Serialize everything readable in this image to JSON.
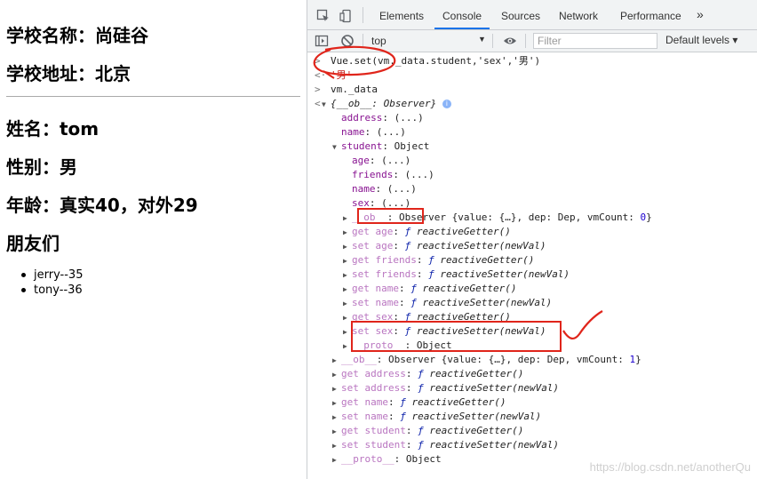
{
  "page": {
    "school_name": "学校名称：尚硅谷",
    "school_address": "学校地址：北京",
    "student_name": "姓名：tom",
    "student_sex": "性别：男",
    "student_age": "年龄：真实40，对外29",
    "friends_heading": "朋友们",
    "friends": [
      "jerry--35",
      "tony--36"
    ]
  },
  "devtools": {
    "tabs": [
      "Elements",
      "Console",
      "Sources",
      "Network",
      "Performance"
    ],
    "active_tab": "Console",
    "more_tabs_icon": "»",
    "context": "top",
    "filter_placeholder": "Filter",
    "levels": "Default levels ▾",
    "console_lines": [
      {
        "gutter": ">",
        "indent": 0,
        "html": "Vue.set(vm._data.student,'sex','男')",
        "kind": "input"
      },
      {
        "gutter": "<·",
        "indent": 0,
        "html": "'男'",
        "kind": "result"
      },
      {
        "gutter": ">",
        "indent": 0,
        "html": "vm._data",
        "kind": "input"
      },
      {
        "gutter": "<·",
        "indent": 0,
        "tri": "▼",
        "parts": [
          [
            "obj",
            "{__ob__: Observer}"
          ]
        ],
        "info": true
      },
      {
        "indent": 1,
        "parts": [
          [
            "k",
            "address"
          ],
          [
            "v",
            ": (...)"
          ]
        ]
      },
      {
        "indent": 1,
        "parts": [
          [
            "k",
            "name"
          ],
          [
            "v",
            ": (...)"
          ]
        ]
      },
      {
        "indent": 1,
        "tri": "▼",
        "parts": [
          [
            "k",
            "student"
          ],
          [
            "v",
            ": Object"
          ]
        ]
      },
      {
        "indent": 2,
        "parts": [
          [
            "k",
            "age"
          ],
          [
            "v",
            ": (...)"
          ]
        ]
      },
      {
        "indent": 2,
        "parts": [
          [
            "k",
            "friends"
          ],
          [
            "v",
            ": (...)"
          ]
        ]
      },
      {
        "indent": 2,
        "parts": [
          [
            "k",
            "name"
          ],
          [
            "v",
            ": (...)"
          ]
        ]
      },
      {
        "indent": 2,
        "parts": [
          [
            "k",
            "sex"
          ],
          [
            "v",
            ": (...)"
          ]
        ]
      },
      {
        "indent": 2,
        "tri": "▶",
        "parts": [
          [
            "kd",
            "__ob__"
          ],
          [
            "v",
            ": Observer {value: {…}, dep: Dep, vmCount: "
          ],
          [
            "n",
            "0"
          ],
          [
            "v",
            "}"
          ]
        ]
      },
      {
        "indent": 2,
        "tri": "▶",
        "parts": [
          [
            "kd",
            "get age"
          ],
          [
            "v",
            ": "
          ],
          [
            "fs",
            "ƒ "
          ],
          [
            "f",
            "reactiveGetter()"
          ]
        ]
      },
      {
        "indent": 2,
        "tri": "▶",
        "parts": [
          [
            "kd",
            "set age"
          ],
          [
            "v",
            ": "
          ],
          [
            "fs",
            "ƒ "
          ],
          [
            "f",
            "reactiveSetter(newVal)"
          ]
        ]
      },
      {
        "indent": 2,
        "tri": "▶",
        "parts": [
          [
            "kd",
            "get friends"
          ],
          [
            "v",
            ": "
          ],
          [
            "fs",
            "ƒ "
          ],
          [
            "f",
            "reactiveGetter()"
          ]
        ]
      },
      {
        "indent": 2,
        "tri": "▶",
        "parts": [
          [
            "kd",
            "set friends"
          ],
          [
            "v",
            ": "
          ],
          [
            "fs",
            "ƒ "
          ],
          [
            "f",
            "reactiveSetter(newVal)"
          ]
        ]
      },
      {
        "indent": 2,
        "tri": "▶",
        "parts": [
          [
            "kd",
            "get name"
          ],
          [
            "v",
            ": "
          ],
          [
            "fs",
            "ƒ "
          ],
          [
            "f",
            "reactiveGetter()"
          ]
        ]
      },
      {
        "indent": 2,
        "tri": "▶",
        "parts": [
          [
            "kd",
            "set name"
          ],
          [
            "v",
            ": "
          ],
          [
            "fs",
            "ƒ "
          ],
          [
            "f",
            "reactiveSetter(newVal)"
          ]
        ]
      },
      {
        "indent": 2,
        "tri": "▶",
        "parts": [
          [
            "kd",
            "get sex"
          ],
          [
            "v",
            ": "
          ],
          [
            "fs",
            "ƒ "
          ],
          [
            "f",
            "reactiveGetter()"
          ]
        ]
      },
      {
        "indent": 2,
        "tri": "▶",
        "parts": [
          [
            "kd",
            "set sex"
          ],
          [
            "v",
            ": "
          ],
          [
            "fs",
            "ƒ "
          ],
          [
            "f",
            "reactiveSetter(newVal)"
          ]
        ]
      },
      {
        "indent": 2,
        "tri": "▶",
        "parts": [
          [
            "kd",
            "__proto__"
          ],
          [
            "v",
            ": Object"
          ]
        ]
      },
      {
        "indent": 1,
        "tri": "▶",
        "parts": [
          [
            "kd",
            "__ob__"
          ],
          [
            "v",
            ": Observer {value: {…}, dep: Dep, vmCount: "
          ],
          [
            "n",
            "1"
          ],
          [
            "v",
            "}"
          ]
        ]
      },
      {
        "indent": 1,
        "tri": "▶",
        "parts": [
          [
            "kd",
            "get address"
          ],
          [
            "v",
            ": "
          ],
          [
            "fs",
            "ƒ "
          ],
          [
            "f",
            "reactiveGetter()"
          ]
        ]
      },
      {
        "indent": 1,
        "tri": "▶",
        "parts": [
          [
            "kd",
            "set address"
          ],
          [
            "v",
            ": "
          ],
          [
            "fs",
            "ƒ "
          ],
          [
            "f",
            "reactiveSetter(newVal)"
          ]
        ]
      },
      {
        "indent": 1,
        "tri": "▶",
        "parts": [
          [
            "kd",
            "get name"
          ],
          [
            "v",
            ": "
          ],
          [
            "fs",
            "ƒ "
          ],
          [
            "f",
            "reactiveGetter()"
          ]
        ]
      },
      {
        "indent": 1,
        "tri": "▶",
        "parts": [
          [
            "kd",
            "set name"
          ],
          [
            "v",
            ": "
          ],
          [
            "fs",
            "ƒ "
          ],
          [
            "f",
            "reactiveSetter(newVal)"
          ]
        ]
      },
      {
        "indent": 1,
        "tri": "▶",
        "parts": [
          [
            "kd",
            "get student"
          ],
          [
            "v",
            ": "
          ],
          [
            "fs",
            "ƒ "
          ],
          [
            "f",
            "reactiveGetter()"
          ]
        ]
      },
      {
        "indent": 1,
        "tri": "▶",
        "parts": [
          [
            "kd",
            "set student"
          ],
          [
            "v",
            ": "
          ],
          [
            "fs",
            "ƒ "
          ],
          [
            "f",
            "reactiveSetter(newVal)"
          ]
        ]
      },
      {
        "indent": 1,
        "tri": "▶",
        "parts": [
          [
            "kd",
            "__proto__"
          ],
          [
            "v",
            ": Object"
          ]
        ]
      }
    ],
    "watermark": "https://blog.csdn.net/anotherQu"
  },
  "colors": {
    "annotation_red": "#e0251b",
    "tab_active_underline": "#1a73e8",
    "key_purple": "#881391",
    "string_red": "#c41a16"
  }
}
